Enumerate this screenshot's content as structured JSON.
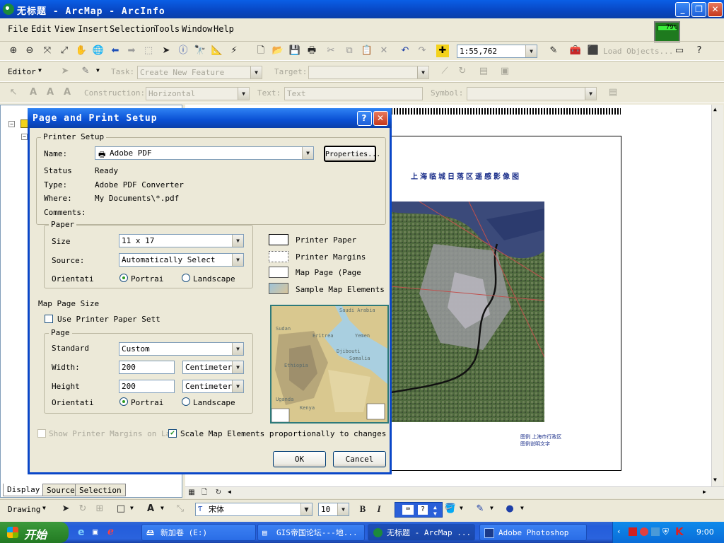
{
  "window": {
    "title": "无标题 - ArcMap - ArcInfo",
    "minimize": "_",
    "maximize": "❐",
    "close": "✕"
  },
  "menu": [
    "File",
    "Edit",
    "View",
    "Insert",
    "Selection",
    "Tools",
    "Window",
    "Help"
  ],
  "toolbar": {
    "scale": "1:55,762",
    "load_objects": "Load Objects...",
    "perf_meter": "79%"
  },
  "editor": {
    "label": "Editor",
    "task_label": "Task:",
    "task_value": "Create New Feature",
    "target_label": "Target:",
    "target_value": ""
  },
  "construction": {
    "label": "Construction:",
    "value": "Horizontal",
    "text_label": "Text:",
    "text_value": "Text",
    "symbol_label": "Symbol:",
    "symbol_value": ""
  },
  "left_tabs": [
    "Display",
    "Source",
    "Selection"
  ],
  "map": {
    "title": "上海临城日落区遥感影像图",
    "legend_line1": "图例  上海市行政区",
    "legend_line2": "图例说明文字"
  },
  "dialog": {
    "title": "Page and Print Setup",
    "help_btn": "?",
    "close_btn": "✕",
    "printer_setup": "Printer Setup",
    "name_label": "Name:",
    "name_value": "Adobe PDF",
    "properties_btn": "Properties...",
    "status_label": "Status",
    "status_value": "Ready",
    "type_label": "Type:",
    "type_value": "Adobe PDF Converter",
    "where_label": "Where:",
    "where_value": "My Documents\\*.pdf",
    "comments_label": "Comments:",
    "paper_group": "Paper",
    "size_label": "Size",
    "size_value": "11 x 17",
    "source_label": "Source:",
    "source_value": "Automatically Select",
    "orientation_label": "Orientati",
    "portrait": "Portrai",
    "landscape": "Landscape",
    "legend": [
      "Printer Paper",
      "Printer Margins",
      "Map Page (Page",
      "Sample Map Elements"
    ],
    "map_page_size": "Map Page Size",
    "use_printer_paper": "Use Printer Paper Sett",
    "page_group": "Page",
    "standard_label": "Standard",
    "standard_value": "Custom",
    "width_label": "Width:",
    "width_value": "200",
    "width_unit": "Centimeters",
    "height_label": "Height",
    "height_value": "200",
    "height_unit": "Centimeters",
    "orientation2_label": "Orientati",
    "portrait2": "Portrai",
    "landscape2": "Landscape",
    "show_margins": "Show Printer Margins on Lay",
    "scale_elements": "Scale Map Elements proportionally to changes in P",
    "ok": "OK",
    "cancel": "Cancel",
    "preview_labels": [
      "Saudi Arabia",
      "Sudan",
      "Eritrea",
      "Yemen",
      "Djibouti",
      "Ethiopia",
      "Somalia",
      "Kenya",
      "Uganda"
    ]
  },
  "drawing": {
    "label": "Drawing",
    "font": "宋体",
    "size": "10",
    "bold": "B",
    "italic": "I"
  },
  "taskbar": {
    "start": "开始",
    "tasks": [
      "新加卷 (E:)",
      "GIS帝国论坛---地...",
      "无标题 - ArcMap ...",
      "Adobe Photoshop"
    ],
    "clock": "9:00"
  }
}
